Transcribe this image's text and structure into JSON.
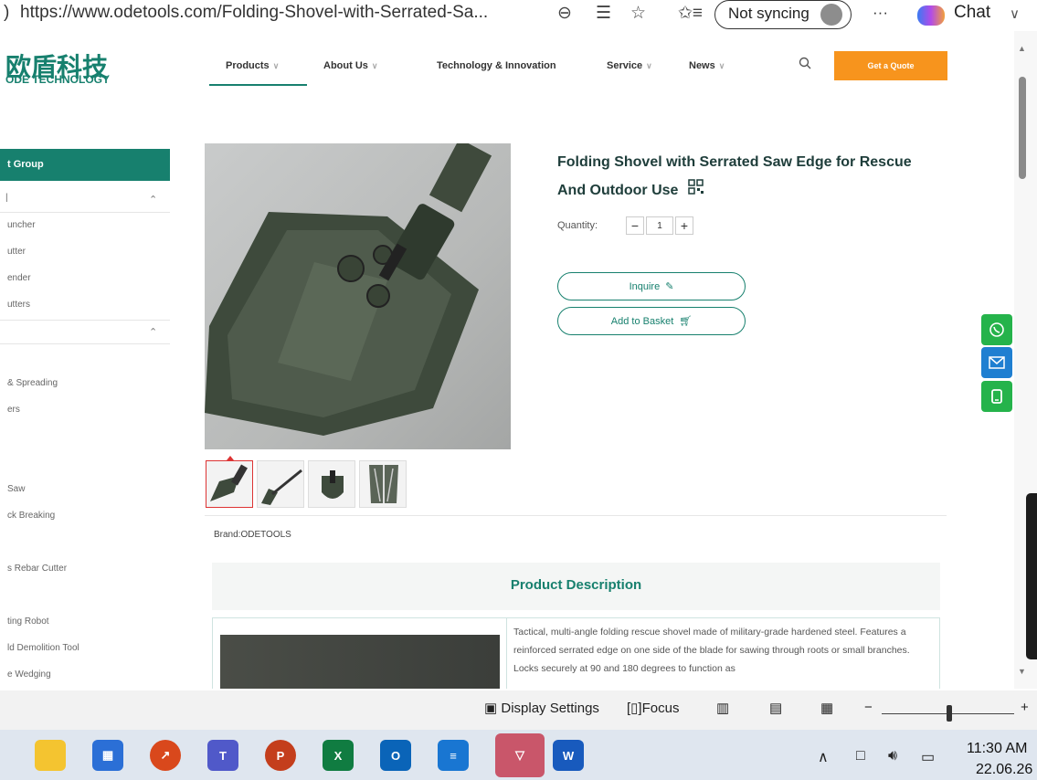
{
  "browser": {
    "url": "https://www.odetools.com/Folding-Shovel-with-Serrated-Sa...",
    "sync_label": "Not syncing",
    "chat_label": "Chat",
    "more_label": "···"
  },
  "site": {
    "logo_cn": "欧盾科技",
    "logo_en": "ODE TECHNOLOGY",
    "nav": {
      "products": "Products",
      "about": "About Us",
      "tech": "Technology & Innovation",
      "service": "Service",
      "news": "News"
    },
    "quote_button": "Get a Quote",
    "accent": "#17806e",
    "cta_color": "#f7941d"
  },
  "sidebar": {
    "heading": "t Group",
    "items": [
      "uncher",
      "utter",
      "ender",
      "utters",
      "& Spreading",
      "ers",
      "Saw",
      "ck Breaking",
      "s Rebar Cutter",
      "ting Robot",
      "ld Demolition Tool",
      "e Wedging"
    ]
  },
  "product": {
    "title": "Folding Shovel with Serrated Saw Edge for Rescue And Outdoor Use",
    "quantity_label": "Quantity:",
    "quantity_value": "1",
    "inquire_label": "Inquire",
    "basket_label": "Add to Basket",
    "brand": "Brand:ODETOOLS",
    "description_heading": "Product Description",
    "description_text": "Tactical, multi-angle folding rescue shovel made of military-grade hardened steel. Features a reinforced serrated edge on one side of the blade for sawing through roots or small branches. Locks securely at 90 and 180 degrees to function as"
  },
  "reader": {
    "display_settings": "Display Settings",
    "focus": "Focus",
    "zoom_minus": "−",
    "zoom_plus": "+"
  },
  "taskbar": {
    "time": "11:30 AM",
    "date": "22.06.26"
  }
}
